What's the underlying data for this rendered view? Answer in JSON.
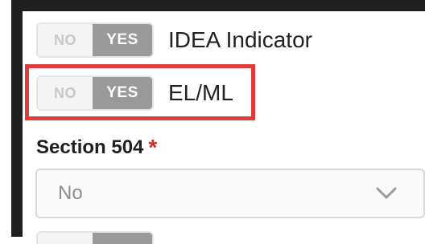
{
  "toggles": [
    {
      "no_label": "NO",
      "yes_label": "YES",
      "label": "IDEA Indicator",
      "selected": "YES"
    },
    {
      "no_label": "NO",
      "yes_label": "YES",
      "label": "EL/ML",
      "selected": "YES"
    }
  ],
  "section_504": {
    "label": "Section 504",
    "required_mark": "*",
    "select_value": "No"
  },
  "icons": {
    "dropdown": "chevron-down-icon"
  },
  "colors": {
    "highlight": "#e03c3c",
    "required": "#d42a2a",
    "toggle_selected": "#9a9a9a"
  }
}
